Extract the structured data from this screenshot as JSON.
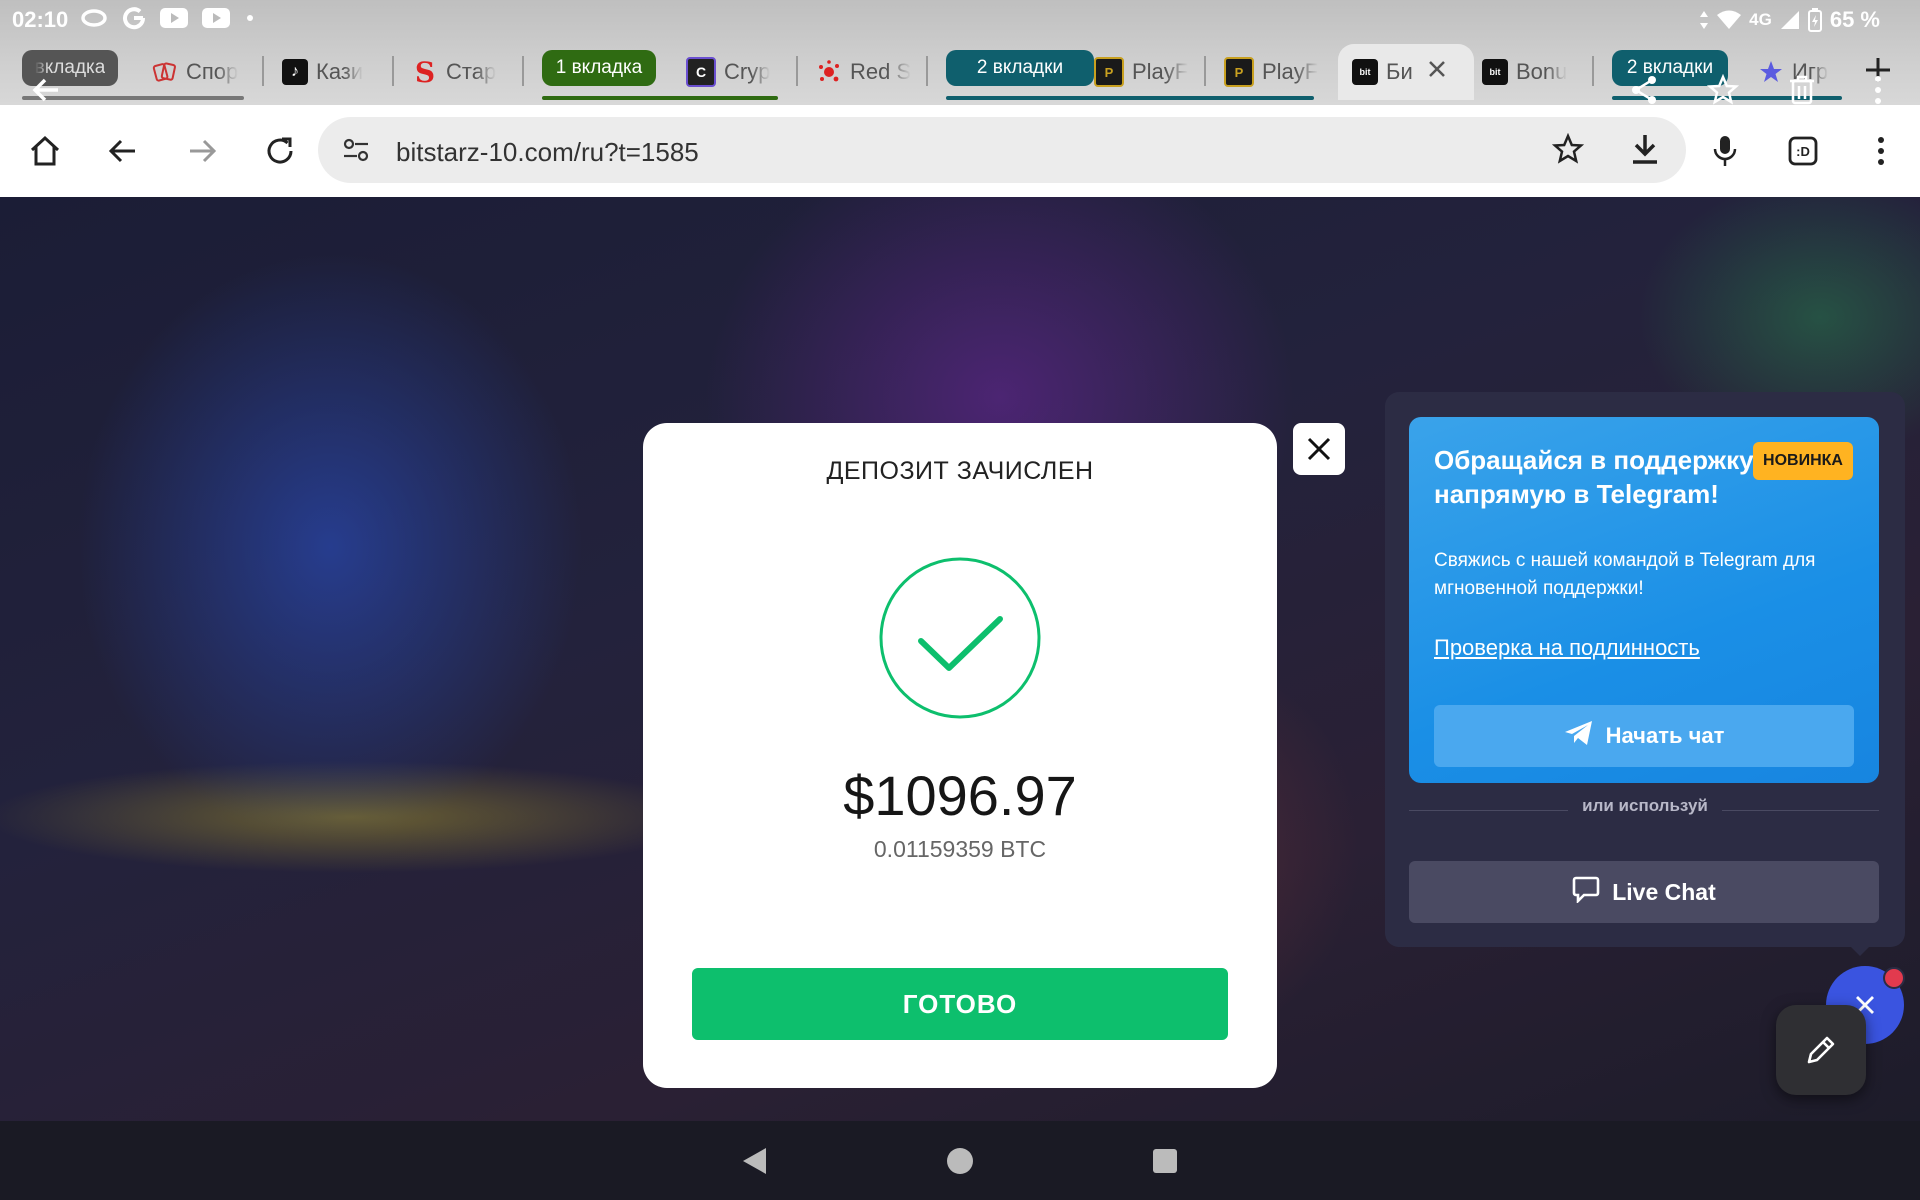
{
  "status_bar": {
    "time": "02:10",
    "network": "4G",
    "battery": "65 %",
    "icons": [
      "threads-icon",
      "google-icon",
      "youtube-icon",
      "youtube-icon",
      "dot-icon"
    ]
  },
  "tabs": {
    "items": [
      {
        "label": "вкладка",
        "kind": "group-pill-partial"
      },
      {
        "label": "Спор",
        "favicon": "cards-icon"
      },
      {
        "label": "Кази",
        "favicon": "tiktok-icon"
      },
      {
        "label": "Стар",
        "favicon": "s-logo-icon"
      },
      {
        "label": "1 вкладка",
        "kind": "group-pill"
      },
      {
        "label": "Cryp",
        "favicon": "c-logo-icon"
      },
      {
        "label": "Red S",
        "favicon": "red-splat-icon"
      },
      {
        "label": "2 вкладки",
        "kind": "group-pill"
      },
      {
        "label": "PlayF",
        "favicon": "playfortuna-icon"
      },
      {
        "label": "PlayF",
        "favicon": "playfortuna-icon"
      },
      {
        "label": "Би",
        "favicon": "bitstarz-icon",
        "active": true
      },
      {
        "label": "Bonu",
        "favicon": "bitstarz-icon"
      },
      {
        "label": "2 вкладки",
        "kind": "group-pill"
      },
      {
        "label": "Игр",
        "favicon": "star-icon"
      }
    ],
    "colors": {
      "group1": "#2f6b12",
      "group2": "#0f5f6d",
      "group3": "#0f5f6d"
    }
  },
  "toolbar": {
    "url": "bitstarz-10.com/ru?t=1585"
  },
  "deposit_modal": {
    "title": "ДЕПОЗИТ ЗАЧИСЛЕН",
    "amount": "$1096.97",
    "crypto_amount": "0.01159359 BTC",
    "done_label": "ГОТОВО",
    "accent": "#0dbf6d"
  },
  "support_widget": {
    "telegram_title": "Обращайся в поддержку напрямую в Telegram!",
    "badge": "НОВИНКА",
    "description": "Свяжись с нашей командой в Telegram для мгновенной поддержки!",
    "verify_link": "Проверка на подлинность",
    "start_chat_label": "Начать чат",
    "or_text": "или используй",
    "live_chat_label": "Live Chat"
  }
}
